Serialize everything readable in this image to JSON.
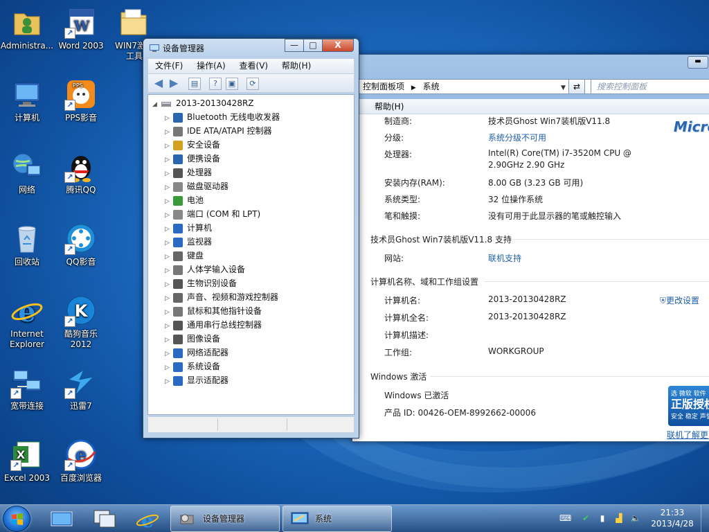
{
  "desktop": {
    "icons": [
      {
        "label": "Administra...",
        "icon": "user-folder-icon"
      },
      {
        "label": "Word 2003",
        "icon": "word-icon"
      },
      {
        "label": "WIN7激活工具",
        "icon": "folder-icon"
      },
      {
        "label": "计算机",
        "icon": "computer-icon"
      },
      {
        "label": "PPS影音",
        "icon": "pps-icon"
      },
      {
        "label": "网络",
        "icon": "network-icon"
      },
      {
        "label": "腾讯QQ",
        "icon": "qq-icon"
      },
      {
        "label": "回收站",
        "icon": "recycle-bin-icon"
      },
      {
        "label": "QQ影音",
        "icon": "qqplayer-icon"
      },
      {
        "label": "Internet Explorer",
        "icon": "ie-icon"
      },
      {
        "label": "酷狗音乐2012",
        "icon": "kugou-icon"
      },
      {
        "label": "宽带连接",
        "icon": "broadband-icon"
      },
      {
        "label": "迅雷7",
        "icon": "thunder-icon"
      },
      {
        "label": "Excel 2003",
        "icon": "excel-icon"
      },
      {
        "label": "百度浏览器",
        "icon": "baidu-browser-icon"
      }
    ]
  },
  "device_manager": {
    "title": "设备管理器",
    "menu": [
      "文件(F)",
      "操作(A)",
      "查看(V)",
      "帮助(H)"
    ],
    "root": "2013-20130428RZ",
    "categories": [
      "Bluetooth 无线电收发器",
      "IDE ATA/ATAPI 控制器",
      "安全设备",
      "便携设备",
      "处理器",
      "磁盘驱动器",
      "电池",
      "端口 (COM 和 LPT)",
      "计算机",
      "监视器",
      "键盘",
      "人体学输入设备",
      "生物识别设备",
      "声音、视频和游戏控制器",
      "鼠标和其他指针设备",
      "通用串行总线控制器",
      "图像设备",
      "网络适配器",
      "系统设备",
      "显示适配器"
    ],
    "caption": {
      "minimize": "—",
      "maximize": "□",
      "close": "X"
    }
  },
  "system_window": {
    "address": [
      "控制面板项",
      "系统"
    ],
    "search_placeholder": "搜索控制面板",
    "menu_help": "帮助(H)",
    "brand": "Micros",
    "rows": [
      {
        "label": "制造商:",
        "value": "技术员Ghost Win7装机版V11.8"
      },
      {
        "label": "分级:",
        "value": "系统分级不可用",
        "link": true
      },
      {
        "label": "处理器:",
        "value": "Intel(R) Core(TM) i7-3520M CPU @",
        "value2": "2.90GHz   2.90 GHz"
      },
      {
        "label": "安装内存(RAM):",
        "value": "8.00 GB (3.23 GB 可用)"
      },
      {
        "label": "系统类型:",
        "value": "32 位操作系统"
      },
      {
        "label": "笔和触摸:",
        "value": "没有可用于此显示器的笔或触控输入"
      }
    ],
    "support_section": "技术员Ghost Win7装机版V11.8 支持",
    "website_label": "网站:",
    "website_value": "联机支持",
    "computer_section": "计算机名称、域和工作组设置",
    "computer_rows": [
      {
        "label": "计算机名:",
        "value": "2013-20130428RZ"
      },
      {
        "label": "计算机全名:",
        "value": "2013-20130428RZ"
      },
      {
        "label": "计算机描述:",
        "value": ""
      },
      {
        "label": "工作组:",
        "value": "WORKGROUP"
      }
    ],
    "change_settings": "更改设置",
    "activation_section": "Windows 激活",
    "activated": "Windows 已激活",
    "product_id": "产品 ID: 00426-OEM-8992662-00006",
    "genuine_top": "选 微软 软件",
    "genuine_big": "正版授权",
    "genuine_small": "安全 稳定 声誉",
    "learn_more": "联机了解更多"
  },
  "taskbar": {
    "buttons": [
      "设备管理器",
      "系统"
    ],
    "time": "21:33",
    "date": "2013/4/28"
  }
}
